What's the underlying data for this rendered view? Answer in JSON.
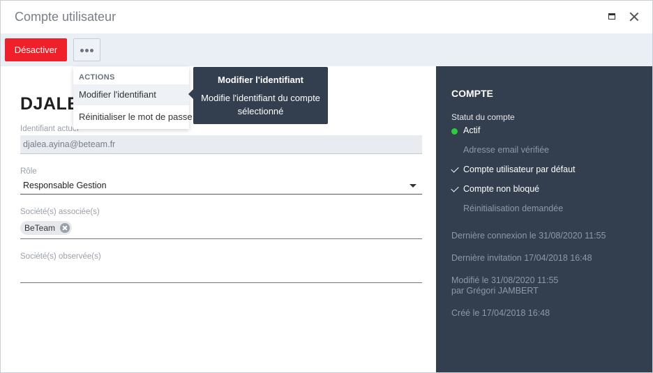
{
  "window": {
    "title": "Compte utilisateur"
  },
  "toolbar": {
    "deactivate_label": "Désactiver"
  },
  "user": {
    "name": "DJALE",
    "current_id_label": "Identifiant actuel",
    "current_id_value": "djalea.ayina@beteam.fr",
    "role_label": "Rôle",
    "role_value": "Responsable Gestion",
    "companies_label": "Société(s) associée(s)",
    "companies": [
      "BeTeam"
    ],
    "observed_label": "Société(s) observée(s)"
  },
  "menu": {
    "header": "ACTIONS",
    "items": [
      "Modifier l'identifiant",
      "Réinitialiser le mot de passe"
    ]
  },
  "tooltip": {
    "title": "Modifier l'identifiant",
    "text": "Modifie l'identifiant du compte sélectionné"
  },
  "account": {
    "title": "COMPTE",
    "status_label": "Statut du compte",
    "statuses": [
      {
        "label": "Actif",
        "state": "active"
      },
      {
        "label": "Adresse email vérifiée",
        "state": "off"
      },
      {
        "label": "Compte utilisateur par défaut",
        "state": "checked"
      },
      {
        "label": "Compte non bloqué",
        "state": "checked"
      },
      {
        "label": "Réinitialisation demandée",
        "state": "off"
      }
    ],
    "last_login": "Dernière connexion le  31/08/2020 11:55",
    "last_invite": "Dernière invitation  17/04/2018 16:48",
    "modified": "Modifié le  31/08/2020 11:55",
    "modified_by": "par Grégori JAMBERT",
    "created": "Créé le  17/04/2018 16:48"
  },
  "colors": {
    "danger": "#f0202a",
    "panel": "#333e4f",
    "active_dot": "#2ecc40",
    "toolbar_bg": "#eaeff6"
  }
}
